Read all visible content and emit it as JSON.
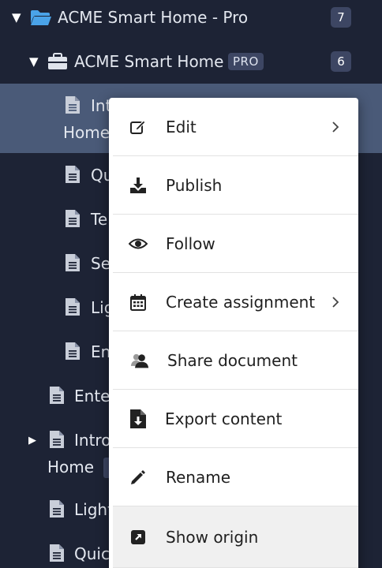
{
  "tree": {
    "root": {
      "label": "ACME Smart Home - Pro",
      "count": "7"
    },
    "folder": {
      "label": "ACME Smart Home",
      "badge": "PRO",
      "count": "6"
    },
    "children": [
      {
        "label": "Int"
      },
      {
        "label_line2": "Home"
      },
      {
        "label": "Qu"
      },
      {
        "label": "Te"
      },
      {
        "label": "Se"
      },
      {
        "label": "Lig"
      },
      {
        "label": "En"
      }
    ],
    "siblings": [
      {
        "label": "Ente"
      },
      {
        "label": "Intro",
        "label_line2": "Home"
      },
      {
        "label": "Light"
      },
      {
        "label": "Quic"
      }
    ]
  },
  "menu": {
    "items": [
      {
        "label": "Edit",
        "icon": "edit-icon",
        "submenu": true
      },
      {
        "label": "Publish",
        "icon": "download-tray-icon",
        "submenu": false
      },
      {
        "label": "Follow",
        "icon": "eye-icon",
        "submenu": false
      },
      {
        "label": "Create assignment",
        "icon": "calendar-icon",
        "submenu": true
      },
      {
        "label": "Share document",
        "icon": "users-icon",
        "submenu": false
      },
      {
        "label": "Export content",
        "icon": "file-export-icon",
        "submenu": false
      },
      {
        "label": "Rename",
        "icon": "pencil-icon",
        "submenu": false
      },
      {
        "label": "Show origin",
        "icon": "external-link-icon",
        "submenu": false
      }
    ],
    "hovered": "Show origin"
  },
  "colors": {
    "sidebar_bg": "#1d2335",
    "selected_bg": "#4a5a78",
    "badge_bg": "#3d4663",
    "folder_blue": "#4aa3e8"
  }
}
